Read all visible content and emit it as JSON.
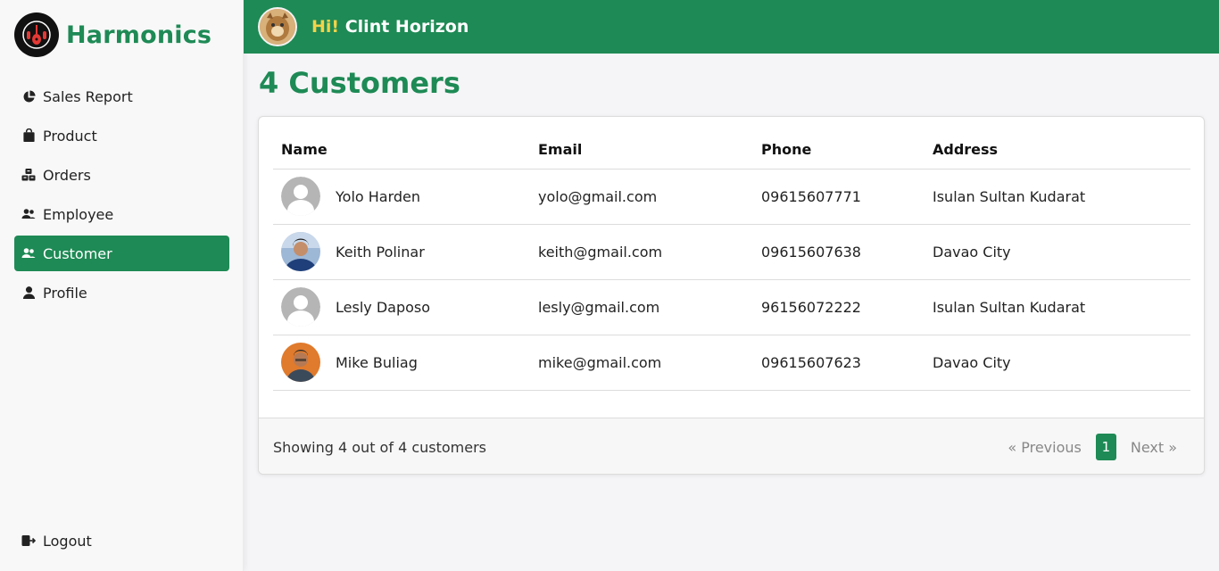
{
  "app": {
    "name": "Harmonics",
    "brand_color": "#1e8a55"
  },
  "sidebar": {
    "items": [
      {
        "label": "Sales Report",
        "icon": "pie-chart-icon"
      },
      {
        "label": "Product",
        "icon": "shopping-bag-icon"
      },
      {
        "label": "Orders",
        "icon": "boxes-icon"
      },
      {
        "label": "Employee",
        "icon": "people-icon"
      },
      {
        "label": "Customer",
        "icon": "people-icon",
        "active": true
      },
      {
        "label": "Profile",
        "icon": "person-icon"
      }
    ],
    "logout": {
      "label": "Logout",
      "icon": "logout-icon"
    }
  },
  "header": {
    "hi": "Hi!",
    "user_name": "Clint Horizon"
  },
  "page": {
    "title": "4 Customers"
  },
  "table": {
    "columns": [
      "Name",
      "Email",
      "Phone",
      "Address"
    ],
    "rows": [
      {
        "name": "Yolo Harden",
        "email": "yolo@gmail.com",
        "phone": "09615607771",
        "address": "Isulan Sultan Kudarat",
        "avatar": "default-avatar"
      },
      {
        "name": "Keith Polinar",
        "email": "keith@gmail.com",
        "phone": "09615607638",
        "address": "Davao City",
        "avatar": "photo-avatar"
      },
      {
        "name": "Lesly Daposo",
        "email": "lesly@gmail.com",
        "phone": "96156072222",
        "address": "Isulan Sultan Kudarat",
        "avatar": "default-avatar"
      },
      {
        "name": "Mike Buliag",
        "email": "mike@gmail.com",
        "phone": "09615607623",
        "address": "Davao City",
        "avatar": "photo-avatar"
      }
    ]
  },
  "footer": {
    "showing": "Showing 4 out of 4 customers",
    "prev": "« Previous",
    "page": "1",
    "next": "Next »"
  }
}
